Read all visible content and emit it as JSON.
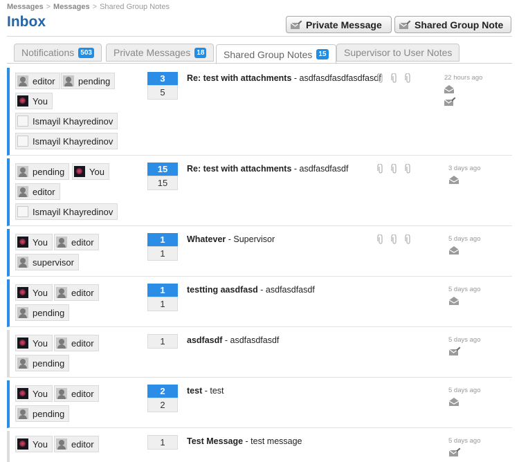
{
  "breadcrumb": [
    "Messages",
    "Messages",
    "Shared Group Notes"
  ],
  "page_title": "Inbox",
  "buttons": {
    "private_message": "Private Message",
    "shared_group_note": "Shared Group Note"
  },
  "tabs": [
    {
      "label": "Notifications",
      "badge": "503"
    },
    {
      "label": "Private Messages",
      "badge": "18"
    },
    {
      "label": "Shared Group Notes",
      "badge": "15"
    },
    {
      "label": "Supervisor to User Notes",
      "badge": ""
    }
  ],
  "threads": [
    {
      "participants": [
        "editor",
        "pending",
        "You",
        "Ismayil Khayredinov",
        "Ismayil Khayredinov"
      ],
      "new_count": "3",
      "total_count": "5",
      "subject": "Re: test with attachments",
      "preview": "asdfasdfasdfasdfasdf",
      "time": "22 hours ago"
    },
    {
      "participants": [
        "pending",
        "You",
        "editor",
        "Ismayil Khayredinov"
      ],
      "new_count": "15",
      "total_count": "15",
      "subject": "Re: test with attachments",
      "preview": "asdfasdfasdf",
      "time": "3 days ago"
    },
    {
      "participants": [
        "You",
        "editor",
        "supervisor"
      ],
      "new_count": "1",
      "total_count": "1",
      "subject": "Whatever",
      "preview": "Supervisor",
      "time": "5 days ago"
    },
    {
      "participants": [
        "You",
        "editor",
        "pending"
      ],
      "new_count": "1",
      "total_count": "1",
      "subject": "testting aasdfasd",
      "preview": "asdfasdfasdf",
      "time": "5 days ago"
    },
    {
      "participants": [
        "You",
        "editor",
        "pending"
      ],
      "new_count": "",
      "total_count": "1",
      "subject": "asdfasdf",
      "preview": "asdfasdfasdf",
      "time": "5 days ago"
    },
    {
      "participants": [
        "You",
        "editor",
        "pending"
      ],
      "new_count": "2",
      "total_count": "2",
      "subject": "test",
      "preview": "test",
      "time": "5 days ago"
    },
    {
      "participants": [
        "You",
        "editor"
      ],
      "new_count": "",
      "total_count": "1",
      "subject": "Test Message",
      "preview": "test message",
      "time": "5 days ago"
    }
  ],
  "colors": {
    "accent": "#2c8de6",
    "title": "#2465a8",
    "badge": "#1e8fe8"
  },
  "icons": [
    "envelope-icon",
    "paperclip-icon",
    "user-avatar-icon",
    "compose-icon"
  ]
}
